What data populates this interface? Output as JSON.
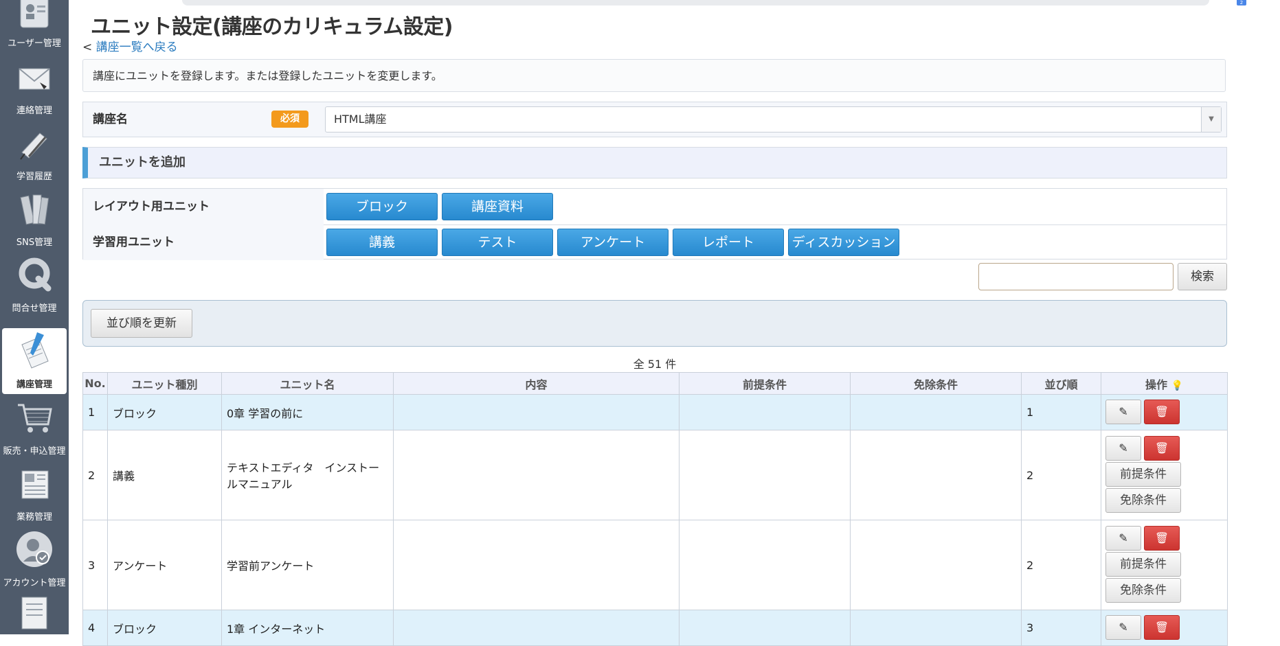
{
  "sidebar": {
    "items": [
      {
        "label": "ユーザー管理",
        "icon": "user-id-icon"
      },
      {
        "label": "連絡管理",
        "icon": "envelope-icon"
      },
      {
        "label": "学習履歴",
        "icon": "pencil-notebook-icon"
      },
      {
        "label": "SNS管理",
        "icon": "books-icon"
      },
      {
        "label": "問合せ管理",
        "icon": "q-letter-icon"
      },
      {
        "label": "講座管理",
        "icon": "document-pen-icon",
        "active": true
      },
      {
        "label": "販売・申込管理",
        "icon": "shopping-cart-icon"
      },
      {
        "label": "業務管理",
        "icon": "newspaper-icon"
      },
      {
        "label": "アカウント管理",
        "icon": "account-check-icon"
      }
    ]
  },
  "header": {
    "title": "ユニット設定(講座のカリキュラム設定)",
    "back_prefix": "< ",
    "back_link": "講座一覧へ戻る",
    "top_badge": "2"
  },
  "description": "講座にユニットを登録します。または登録したユニットを変更します。",
  "course_field": {
    "label": "講座名",
    "required_badge": "必須",
    "value": "HTML講座"
  },
  "add_section": {
    "title": "ユニットを追加",
    "layout_row": {
      "label": "レイアウト用ユニット",
      "buttons": [
        "ブロック",
        "講座資料"
      ]
    },
    "learning_row": {
      "label": "学習用ユニット",
      "buttons": [
        "講義",
        "テスト",
        "アンケート",
        "レポート",
        "ディスカッション"
      ]
    }
  },
  "search": {
    "placeholder": "",
    "button": "検索"
  },
  "sort_button": "並び順を更新",
  "total": "全 51 件",
  "table": {
    "headers": [
      "No.",
      "ユニット種別",
      "ユニット名",
      "内容",
      "前提条件",
      "免除条件",
      "並び順",
      "操作"
    ],
    "rows": [
      {
        "no": "1",
        "type": "ブロック",
        "name": "0章 学習の前に",
        "content": "",
        "prereq": "",
        "exempt": "",
        "order": "1"
      },
      {
        "no": "2",
        "type": "講義",
        "name": "テキストエディタ　インストールマニュアル",
        "content": "",
        "prereq": "",
        "exempt": "",
        "order": "2"
      },
      {
        "no": "3",
        "type": "アンケート",
        "name": "学習前アンケート",
        "content": "",
        "prereq": "",
        "exempt": "",
        "order": "2"
      },
      {
        "no": "4",
        "type": "ブロック",
        "name": "1章 インターネット",
        "content": "",
        "prereq": "",
        "exempt": "",
        "order": "3"
      }
    ],
    "op_prereq": "前提条件",
    "op_exempt": "免除条件"
  },
  "colors": {
    "sidebar_bg": "#4f5b6b",
    "primary_button": "#2789cf",
    "delete_button": "#cc3430",
    "required_badge": "#f39a1c",
    "block_row": "#dff1fb",
    "section_accent": "#4c9fd6"
  }
}
